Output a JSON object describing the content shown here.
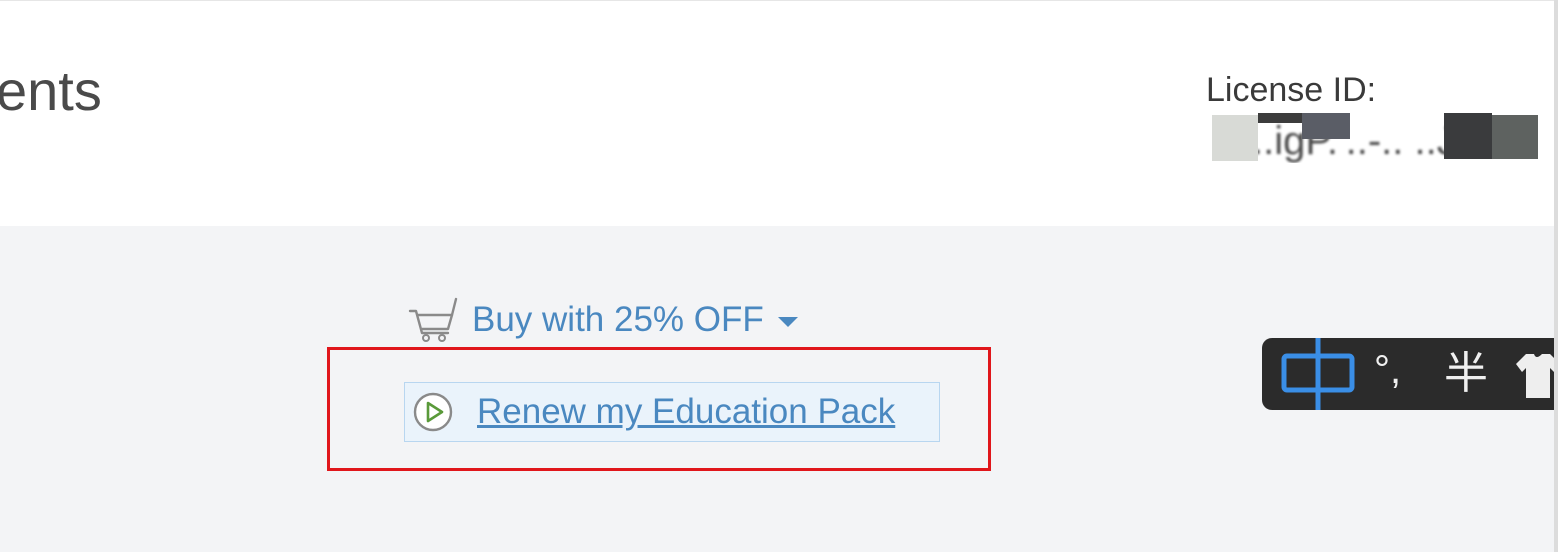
{
  "header": {
    "page_title": "ents",
    "license_label": "License ID:",
    "license_value": "..igP.'..-.. ..JM"
  },
  "actions": {
    "buy_label": "Buy with 25% OFF",
    "renew_label": "Renew my Education Pack"
  },
  "ime_toolbar": {
    "language": "中",
    "punctuation": "°,",
    "width_mode": "半"
  },
  "icons": {
    "cart": "shopping-cart-icon",
    "caret": "caret-down-icon",
    "play": "play-circle-icon",
    "skin": "tshirt-icon"
  },
  "colors": {
    "link": "#4a88c0",
    "highlight_border": "#e0161b",
    "panel_background": "#f3f4f6",
    "play_icon": "#5a9a3a",
    "ime_background": "#2b2b2b",
    "ime_accent": "#3a8ee6"
  }
}
